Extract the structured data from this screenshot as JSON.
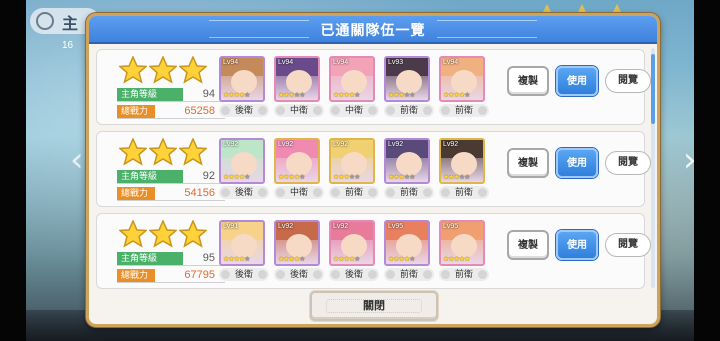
{
  "dialog": {
    "title": "已通關隊伍一覽",
    "close_label": "關閉"
  },
  "labels": {
    "player_level": "主角等級",
    "power": "總戰力",
    "copy": "複製",
    "use": "使用",
    "view": "閱覽"
  },
  "background": {
    "header_title_fragment": "主",
    "header_number_fragment": "16"
  },
  "teams": [
    {
      "stars_earned": 3,
      "player_level": "94",
      "power": "65258",
      "units": [
        {
          "level": "Lv94",
          "rarity": 4,
          "position": "後衛"
        },
        {
          "level": "Lv94",
          "rarity": 3,
          "position": "中衛"
        },
        {
          "level": "Lv94",
          "rarity": 4,
          "position": "中衛"
        },
        {
          "level": "Lv93",
          "rarity": 3,
          "position": "前衛"
        },
        {
          "level": "Lv94",
          "rarity": 4,
          "position": "前衛"
        }
      ]
    },
    {
      "stars_earned": 3,
      "player_level": "92",
      "power": "54156",
      "units": [
        {
          "level": "Lv92",
          "rarity": 4,
          "position": "後衛"
        },
        {
          "level": "Lv92",
          "rarity": 4,
          "position": "中衛"
        },
        {
          "level": "Lv92",
          "rarity": 3,
          "position": "前衛"
        },
        {
          "level": "Lv92",
          "rarity": 3,
          "position": "前衛"
        },
        {
          "level": "Lv92",
          "rarity": 3,
          "position": "前衛"
        }
      ]
    },
    {
      "stars_earned": 3,
      "player_level": "95",
      "power": "67795",
      "units": [
        {
          "level": "Lv91",
          "rarity": 4,
          "position": "後衛"
        },
        {
          "level": "Lv92",
          "rarity": 4,
          "position": "後衛"
        },
        {
          "level": "Lv92",
          "rarity": 4,
          "position": "後衛"
        },
        {
          "level": "Lv95",
          "rarity": 4,
          "position": "前衛"
        },
        {
          "level": "Lv95",
          "rarity": 5,
          "position": "前衛"
        }
      ]
    }
  ],
  "colors": {
    "header_blue": "#4a8de6",
    "use_button_blue": "#3a87e2",
    "level_green": "#4ab06a",
    "power_orange": "#e98f28",
    "dialog_border_gold": "#cfa45a"
  }
}
